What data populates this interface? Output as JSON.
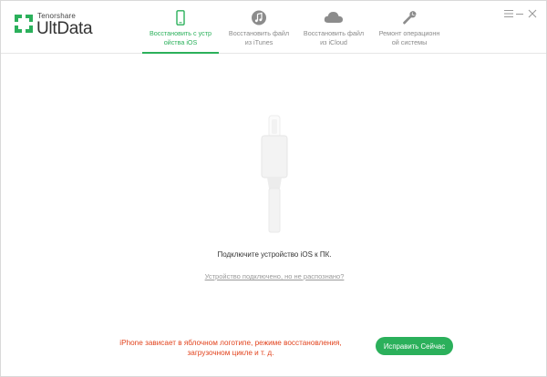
{
  "app": {
    "brand_small": "Tenorshare",
    "brand_name": "UltData"
  },
  "colors": {
    "accent": "#2bb05b",
    "warning": "#e2431d",
    "muted": "#8a8a8a"
  },
  "tabs": [
    {
      "id": "ios",
      "icon": "phone-icon",
      "label_line1": "Восстановить с устр",
      "label_line2": "ойства iOS",
      "active": true
    },
    {
      "id": "itunes",
      "icon": "music-note-icon",
      "label_line1": "Восстановить файл",
      "label_line2": "из iTunes",
      "active": false
    },
    {
      "id": "icloud",
      "icon": "cloud-icon",
      "label_line1": "Восстановить файл",
      "label_line2": "из iCloud",
      "active": false
    },
    {
      "id": "repair",
      "icon": "wrench-icon",
      "label_line1": "Ремонт операционн",
      "label_line2": "ой системы",
      "active": false
    }
  ],
  "window_controls": [
    "menu-icon",
    "minimize-icon",
    "close-icon"
  ],
  "main": {
    "connect_text": "Подключите устройство iOS к ПК.",
    "help_link": "Устройство подключено, но не распознано?",
    "warning_line1": "iPhone зависает в яблочном логотипе, режиме восстановления,",
    "warning_line2": "загрузочном цикле и т. д.",
    "fix_button": "Исправить Сейчас"
  }
}
